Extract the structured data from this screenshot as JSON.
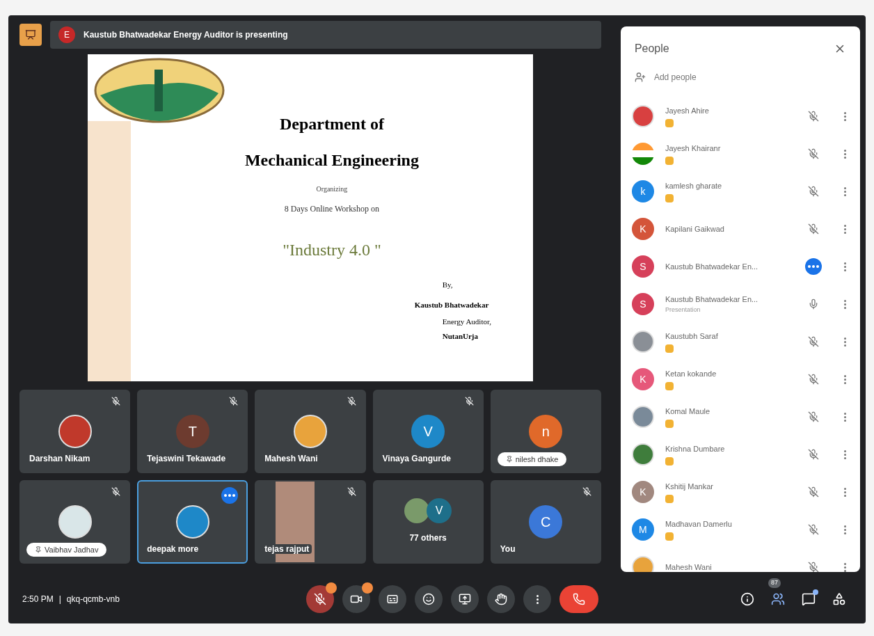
{
  "banner": {
    "avatar": "E",
    "text": "Kaustub Bhatwadekar Energy Auditor is presenting"
  },
  "slide": {
    "title_1": "Department of",
    "title_2": "Mechanical Engineering",
    "line_1": "Organizing",
    "line_2": "8 Days Online Workshop on",
    "topic": "\"Industry 4.0 \"",
    "by": "By,",
    "speaker": "Kaustub Bhatwadekar",
    "role": "Energy Auditor,",
    "org": "NutanUrja"
  },
  "tiles": [
    {
      "name": "Darshan Nikam",
      "kind": "photo",
      "color": "#c0392b",
      "pill": false,
      "selected": false,
      "muted": true,
      "speaking": false
    },
    {
      "name": "Tejaswini Tekawade",
      "kind": "letter",
      "letter": "T",
      "color": "#6d3b2f",
      "pill": false,
      "selected": false,
      "muted": true,
      "speaking": false
    },
    {
      "name": "Mahesh Wani",
      "kind": "photo",
      "color": "#e8a33c",
      "pill": false,
      "selected": false,
      "muted": true,
      "speaking": false
    },
    {
      "name": "Vinaya Gangurde",
      "kind": "letter",
      "letter": "V",
      "color": "#1e88c8",
      "pill": false,
      "selected": false,
      "muted": true,
      "speaking": false
    },
    {
      "name": "nilesh dhake",
      "kind": "letter",
      "letter": "n",
      "color": "#e0692a",
      "pill": true,
      "selected": false,
      "muted": false,
      "speaking": false
    },
    {
      "name": "Vaibhav Jadhav",
      "kind": "photo",
      "color": "#d9e6e8",
      "pill": true,
      "selected": false,
      "muted": true,
      "speaking": false
    },
    {
      "name": "deepak more",
      "kind": "photo",
      "color": "#1e88c8",
      "pill": false,
      "selected": true,
      "muted": false,
      "speaking": true
    },
    {
      "name": "tejas rajput",
      "kind": "video",
      "color": "#b08b7a",
      "pill": false,
      "selected": false,
      "muted": true,
      "speaking": false
    },
    {
      "name": "77 others",
      "kind": "others",
      "letter": "V",
      "color": "#1e6f8a",
      "pill": false,
      "selected": false,
      "muted": false,
      "speaking": false
    },
    {
      "name": "You",
      "kind": "letter",
      "letter": "C",
      "color": "#3b78d8",
      "pill": false,
      "selected": false,
      "muted": true,
      "speaking": false
    }
  ],
  "people": {
    "title": "People",
    "add": "Add people",
    "items": [
      {
        "name": "Jayesh Ahire",
        "kind": "photo",
        "color": "#d84040",
        "badge": true,
        "muted": true,
        "speaking": false
      },
      {
        "name": "Jayesh Khairanr",
        "kind": "flag",
        "color": "#ff9933",
        "badge": true,
        "muted": true,
        "speaking": false
      },
      {
        "name": "kamlesh gharate",
        "kind": "letter",
        "letter": "k",
        "color": "#1e88e5",
        "badge": true,
        "muted": true,
        "speaking": false
      },
      {
        "name": "Kapilani Gaikwad",
        "kind": "letter",
        "letter": "K",
        "color": "#d4553a",
        "badge": false,
        "muted": true,
        "speaking": false
      },
      {
        "name": "Kaustub Bhatwadekar En...",
        "kind": "letter",
        "letter": "S",
        "color": "#d6405a",
        "badge": false,
        "muted": false,
        "speaking": true
      },
      {
        "name": "Kaustub Bhatwadekar En...",
        "sub": "Presentation",
        "kind": "letter",
        "letter": "S",
        "color": "#d6405a",
        "badge": false,
        "muted": false,
        "speaking": false
      },
      {
        "name": "Kaustubh Saraf",
        "kind": "photo",
        "color": "#8a8f96",
        "badge": true,
        "muted": true,
        "speaking": false
      },
      {
        "name": "Ketan kokande",
        "kind": "letter",
        "letter": "K",
        "color": "#e6587a",
        "badge": true,
        "muted": true,
        "speaking": false
      },
      {
        "name": "Komal Maule",
        "kind": "photo",
        "color": "#7a8a99",
        "badge": true,
        "muted": true,
        "speaking": false
      },
      {
        "name": "Krishna Dumbare",
        "kind": "photo",
        "color": "#3f7d3c",
        "badge": true,
        "muted": true,
        "speaking": false
      },
      {
        "name": "Kshitij Mankar",
        "kind": "letter",
        "letter": "K",
        "color": "#a1887f",
        "badge": true,
        "muted": true,
        "speaking": false
      },
      {
        "name": "Madhavan Damerlu",
        "kind": "letter",
        "letter": "M",
        "color": "#1e88e5",
        "badge": true,
        "muted": true,
        "speaking": false
      },
      {
        "name": "Mahesh Wani",
        "kind": "photo",
        "color": "#e8a33c",
        "badge": false,
        "muted": true,
        "speaking": false
      }
    ]
  },
  "bottom": {
    "time": "2:50 PM",
    "separator": "|",
    "code": "qkq-qcmb-vnb",
    "controls": [
      {
        "kind": "mic",
        "alert": true
      },
      {
        "kind": "camera",
        "alert": true
      },
      {
        "kind": "captions",
        "alert": false
      },
      {
        "kind": "emoji",
        "alert": false
      },
      {
        "kind": "present",
        "alert": false
      },
      {
        "kind": "hand",
        "alert": false
      },
      {
        "kind": "more",
        "alert": false
      },
      {
        "kind": "hangup",
        "alert": false
      }
    ],
    "right": [
      {
        "kind": "info"
      },
      {
        "kind": "people",
        "count": "87"
      },
      {
        "kind": "chat",
        "dot": true
      },
      {
        "kind": "activities"
      }
    ]
  }
}
